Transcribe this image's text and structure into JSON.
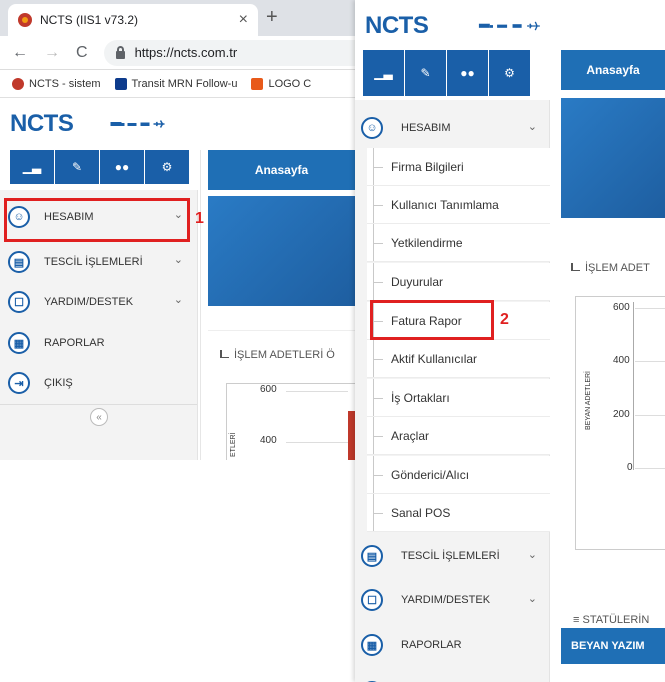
{
  "panel1": {
    "browser": {
      "tab_title": "NCTS (IIS1 v73.2)",
      "tab_close": "×",
      "new_tab": "+",
      "url": "https://ncts.com.tr",
      "bookmarks": [
        "NCTS - sistem",
        "Transit MRN Follow-u",
        "LOGO C"
      ]
    },
    "brand": "NCTS",
    "home_button": "Anasayfa",
    "menu": [
      {
        "label": "HESABIM",
        "has_chevron": true
      },
      {
        "label": "TESCİL İŞLEMLERİ",
        "has_chevron": true
      },
      {
        "label": "YARDIM/DESTEK",
        "has_chevron": true
      },
      {
        "label": "RAPORLAR",
        "has_chevron": false
      },
      {
        "label": "ÇIKIŞ",
        "has_chevron": false
      }
    ],
    "step_marker": "1",
    "collapse_icon": "«",
    "chart_title": "İŞLEM ADETLERİ Ö",
    "chart_ticks": [
      "600",
      "400"
    ],
    "chart_ylabel": "ETLERİ"
  },
  "panel2": {
    "brand": "NCTS",
    "home_button": "Anasayfa",
    "hesabim_label": "HESABIM",
    "submenu": [
      "Firma Bilgileri",
      "Kullanıcı Tanımlama",
      "Yetkilendirme",
      "Duyurular",
      "Fatura Rapor",
      "Aktif Kullanıcılar",
      "İş Ortakları",
      "Araçlar",
      "Gönderici/Alıcı",
      "Sanal POS"
    ],
    "menu_rest": [
      {
        "label": "TESCİL İŞLEMLERİ",
        "has_chevron": true
      },
      {
        "label": "YARDIM/DESTEK",
        "has_chevron": true
      },
      {
        "label": "RAPORLAR",
        "has_chevron": false
      }
    ],
    "step_marker": "2",
    "chart_title": "İŞLEM ADET",
    "chart_ticks": [
      "600",
      "400",
      "200",
      "0"
    ],
    "chart_ylabel": "BEYAN ADETLERİ",
    "status_title": "STATÜLERİN",
    "beyan_button": "BEYAN YAZIM"
  },
  "colors": {
    "brand_blue": "#1a5fa8",
    "highlight_red": "#e02020",
    "sidebar_bg": "#f3f3f3"
  }
}
